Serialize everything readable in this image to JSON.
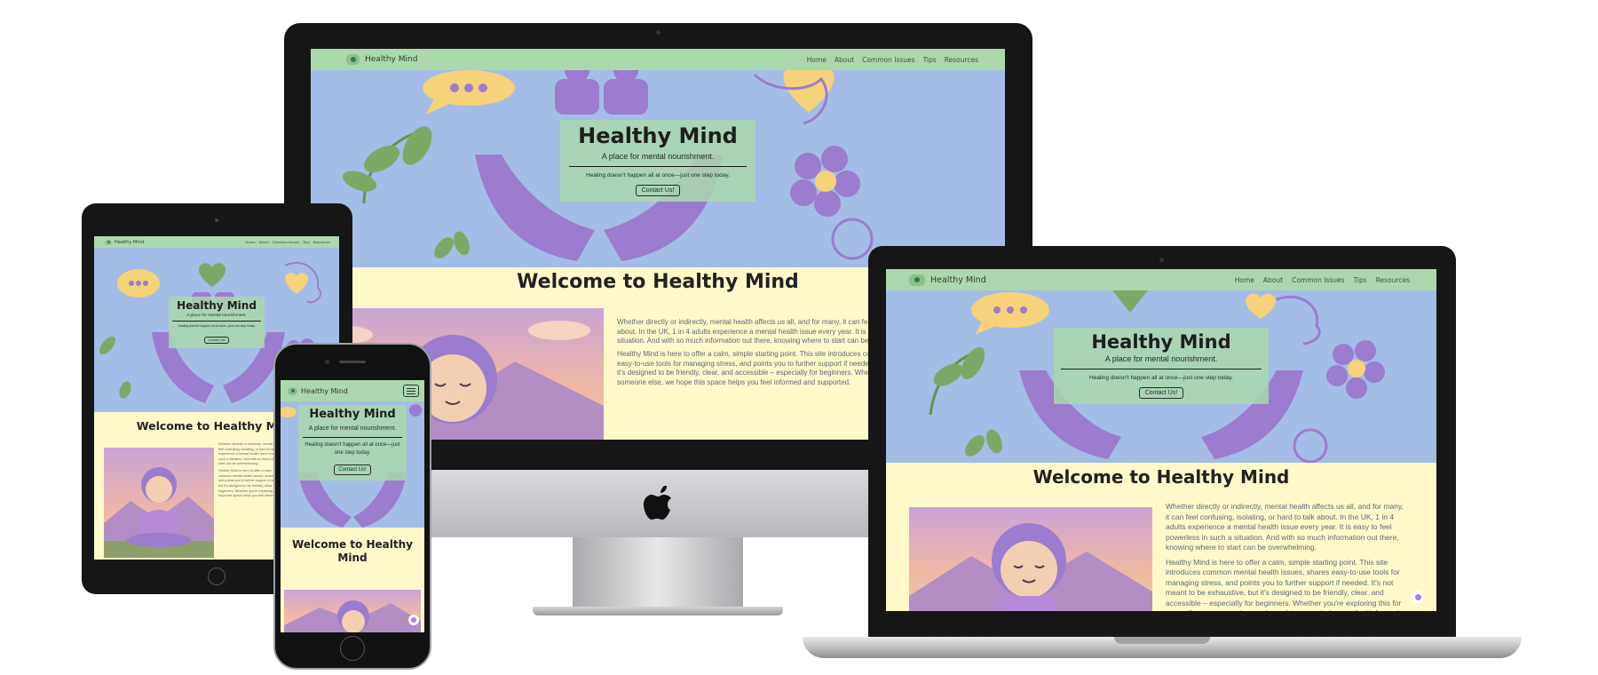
{
  "site": {
    "brand": "Healthy Mind",
    "nav_links": [
      "Home",
      "About",
      "Common Issues",
      "Tips",
      "Resources"
    ],
    "hero": {
      "title": "Healthy Mind",
      "tagline": "A place for mental nourishment.",
      "subtext": "Healing doesn't happen all at once—just one step today.",
      "button": "Contact Us!"
    },
    "welcome_heading": "Welcome to Healthy Mind",
    "paragraphs": [
      "Whether directly or indirectly, mental health affects us all, and for many, it can feel confusing, isolating, or hard to talk about. In the UK, 1 in 4 adults experience a mental health issue every year. It is easy to feel powerless in such a situation. And with so much information out there, knowing where to start can be overwhelming.",
      "Healthy Mind is here to offer a calm, simple starting point. This site introduces common mental health issues, shares easy-to-use tools for managing stress, and points you to further support if needed. It's not meant to be exhaustive, but it's designed to be friendly, clear, and accessible – especially for beginners. Whether you're exploring this for yourself or someone else, we hope this space helps you feel informed and supported."
    ]
  },
  "colors": {
    "nav": "#acd8ad",
    "hero_bg": "#a4bde6",
    "content_bg": "#fff9c9",
    "accent_purple": "#9b7ccf",
    "accent_yellow": "#f6d27a"
  },
  "icons": [
    "heart-icon",
    "flower-icon",
    "leaf-icon",
    "speech-bubble-icon",
    "head-profile-icon",
    "hands-icon",
    "menu-icon",
    "apple-logo-icon",
    "chat-widget-icon"
  ]
}
